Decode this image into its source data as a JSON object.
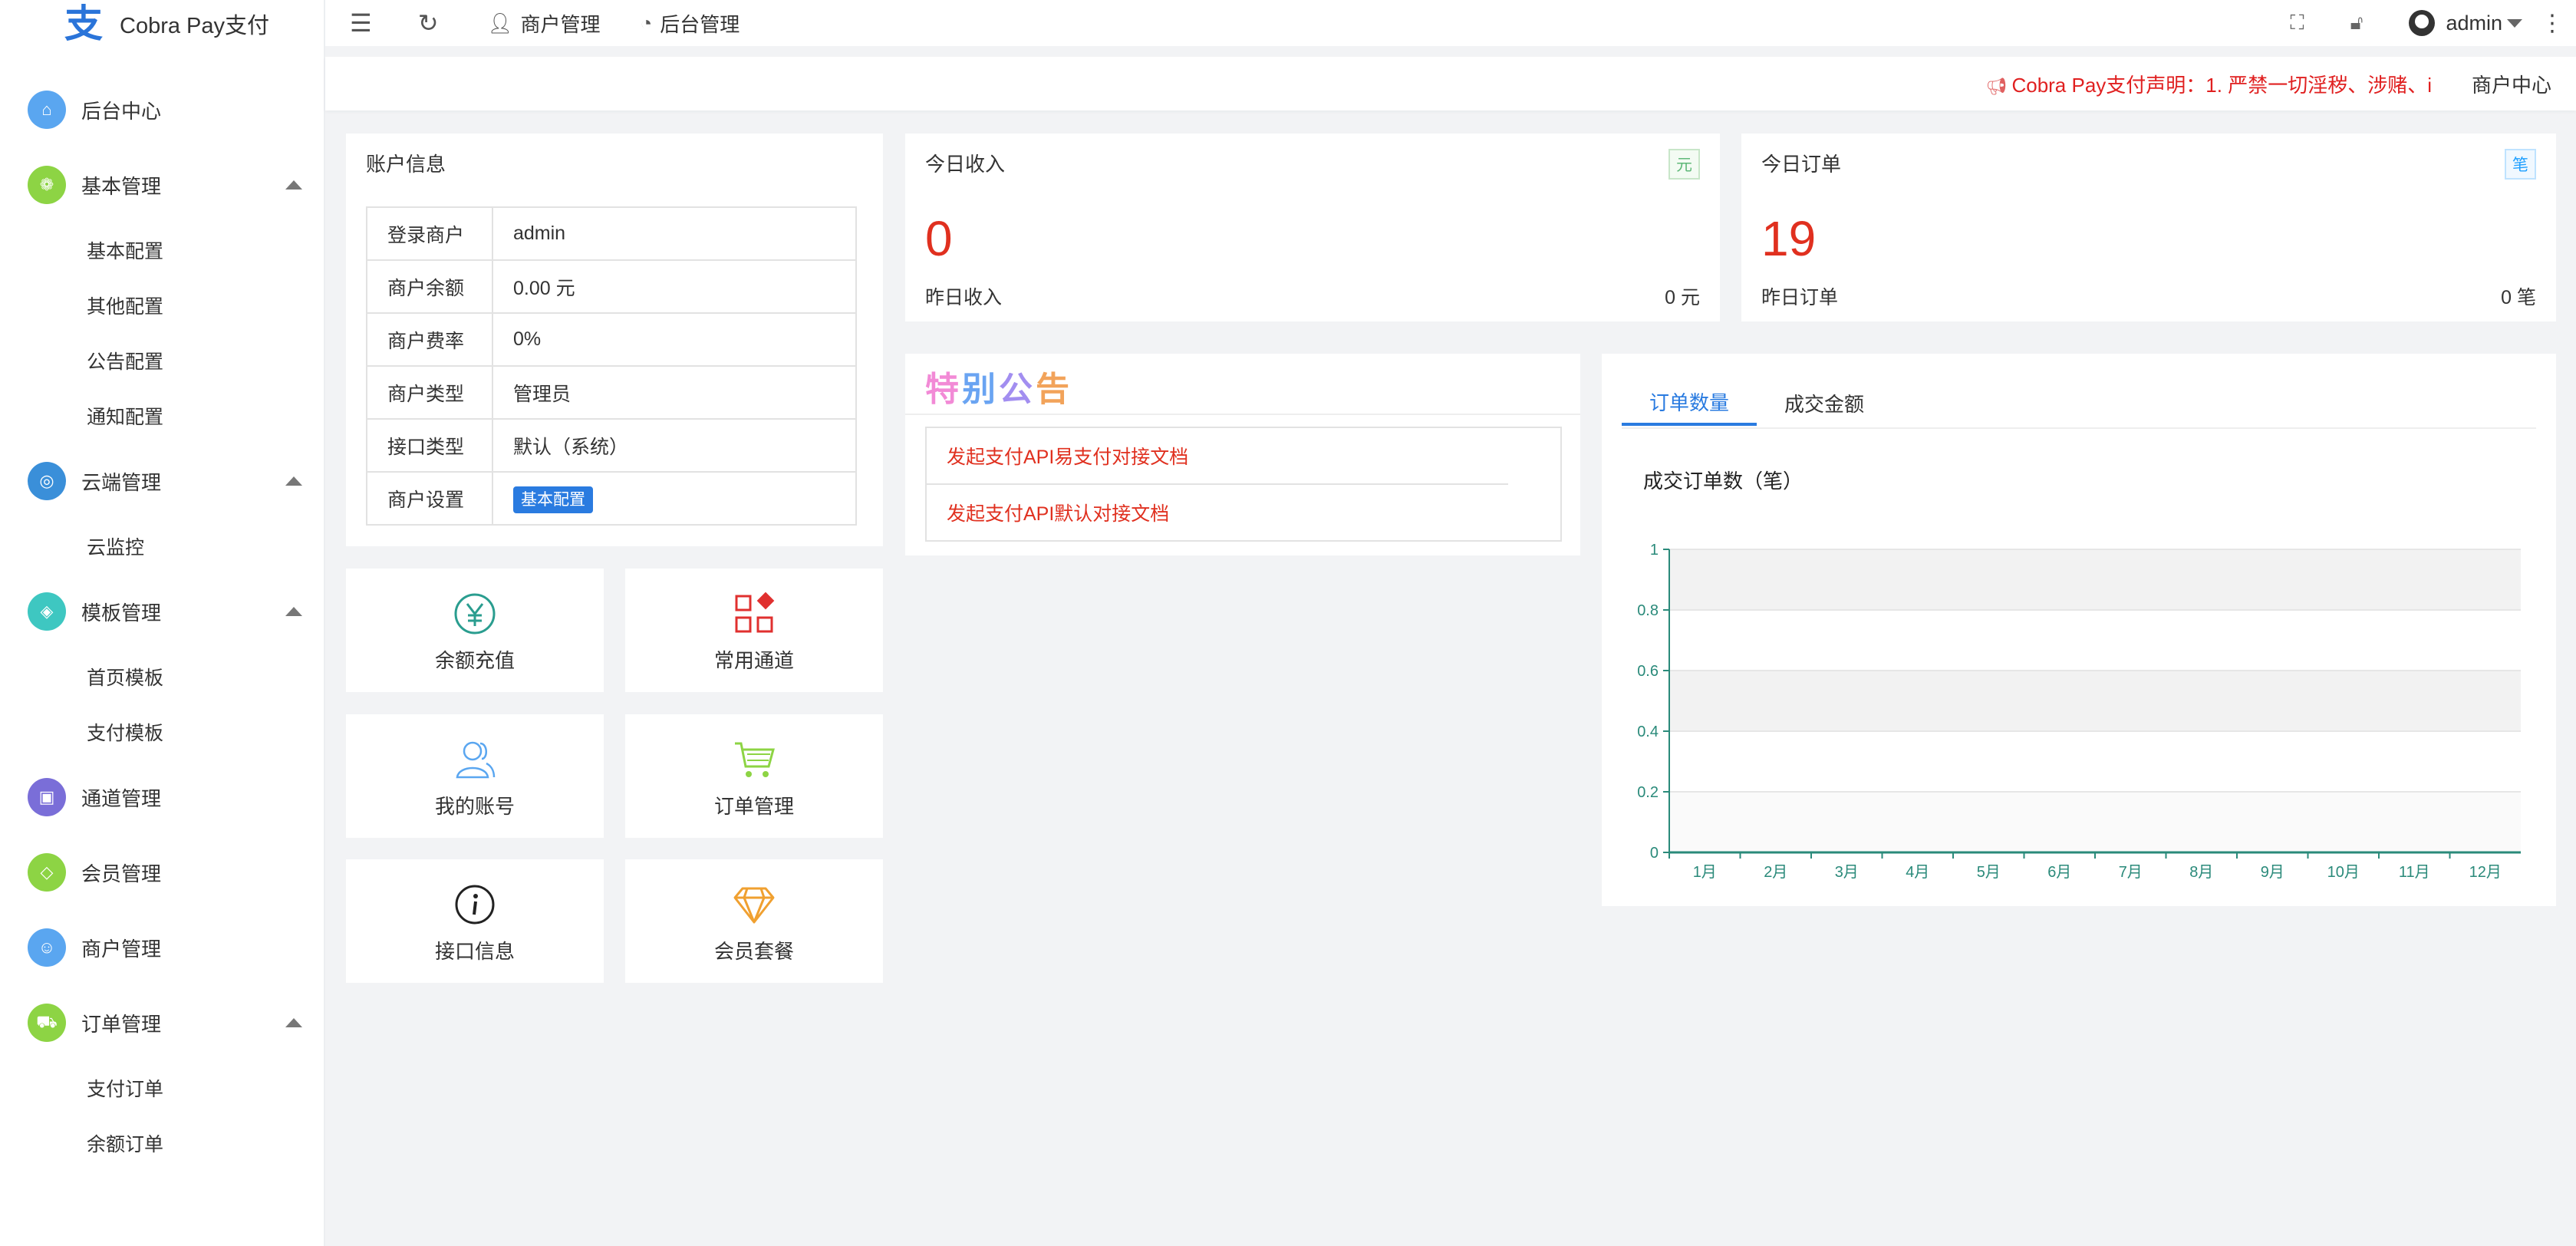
{
  "app": {
    "logo_glyph": "支",
    "title": "Cobra Pay支付"
  },
  "sidebar": {
    "items": [
      {
        "label": "后台中心",
        "color": "#5aa6f0",
        "icon": "home-icon",
        "expanded": null,
        "children": []
      },
      {
        "label": "基本管理",
        "color": "#8dd444",
        "icon": "settings-icon",
        "expanded": true,
        "children": [
          "基本配置",
          "其他配置",
          "公告配置",
          "通知配置"
        ]
      },
      {
        "label": "云端管理",
        "color": "#3a8fd9",
        "icon": "globe-icon",
        "expanded": true,
        "children": [
          "云监控"
        ]
      },
      {
        "label": "模板管理",
        "color": "#3ec7c1",
        "icon": "layers-icon",
        "expanded": true,
        "children": [
          "首页模板",
          "支付模板"
        ]
      },
      {
        "label": "通道管理",
        "color": "#7a6ed8",
        "icon": "channel-icon",
        "expanded": null,
        "children": []
      },
      {
        "label": "会员管理",
        "color": "#8dd444",
        "icon": "diamond-icon",
        "expanded": null,
        "children": []
      },
      {
        "label": "商户管理",
        "color": "#5aa6f0",
        "icon": "user-icon",
        "expanded": null,
        "children": []
      },
      {
        "label": "订单管理",
        "color": "#8dd444",
        "icon": "cart-icon",
        "expanded": true,
        "children": [
          "支付订单",
          "余额订单"
        ]
      }
    ]
  },
  "topbar": {
    "merchant_link": "商户管理",
    "admin_link": "后台管理",
    "user": "admin"
  },
  "subbar": {
    "notice": "Cobra Pay支付声明：1. 严禁一切淫秽、涉赌、i",
    "breadcrumb": "商户中心"
  },
  "account": {
    "title": "账户信息",
    "rows": [
      {
        "key": "登录商户",
        "value": "admin"
      },
      {
        "key": "商户余额",
        "value": "0.00 元"
      },
      {
        "key": "商户费率",
        "value": "0%"
      },
      {
        "key": "商户类型",
        "value": "管理员"
      },
      {
        "key": "接口类型",
        "value": "默认（系统）"
      }
    ],
    "settings_key": "商户设置",
    "settings_button": "基本配置"
  },
  "income": {
    "title": "今日收入",
    "badge": "元",
    "badge_color": "#5fb878",
    "value": "0",
    "sub_label": "昨日收入",
    "sub_value": "0 元"
  },
  "orders": {
    "title": "今日订单",
    "badge": "笔",
    "badge_color": "#1e9fff",
    "value": "19",
    "sub_label": "昨日订单",
    "sub_value": "0 笔"
  },
  "tiles": [
    {
      "label": "余额充值",
      "icon": "yuan-icon",
      "color": "#2a9d8f"
    },
    {
      "label": "常用通道",
      "icon": "apps-icon",
      "color": "#e0302f"
    },
    {
      "label": "我的账号",
      "icon": "users-icon",
      "color": "#5aa6f0"
    },
    {
      "label": "订单管理",
      "icon": "cart-icon",
      "color": "#8dd444"
    },
    {
      "label": "接口信息",
      "icon": "info-icon",
      "color": "#222222"
    },
    {
      "label": "会员套餐",
      "icon": "diamond-icon",
      "color": "#f0a030"
    }
  ],
  "announcement": {
    "title_chars": [
      {
        "ch": "特",
        "color": "#f28ad6"
      },
      {
        "ch": "别",
        "color": "#6aa4f2"
      },
      {
        "ch": "公",
        "color": "#a28ef0"
      },
      {
        "ch": "告",
        "color": "#f2a35a"
      }
    ],
    "links": [
      "发起支付API易支付对接文档",
      "发起支付API默认对接文档"
    ]
  },
  "chart_panel": {
    "tabs": [
      "订单数量",
      "成交金额"
    ],
    "active_tab": 0
  },
  "chart_data": {
    "type": "bar",
    "title": "成交订单数（笔）",
    "categories": [
      "1月",
      "2月",
      "3月",
      "4月",
      "5月",
      "6月",
      "7月",
      "8月",
      "9月",
      "10月",
      "11月",
      "12月"
    ],
    "values": [
      0,
      0,
      0,
      0,
      0,
      0,
      0,
      0,
      0,
      0,
      0,
      0
    ],
    "ylim": [
      0,
      1
    ],
    "yticks": [
      "0",
      "0.2",
      "0.4",
      "0.6",
      "0.8",
      "1"
    ],
    "axis_color": "#2a8a7a",
    "grid": true
  }
}
